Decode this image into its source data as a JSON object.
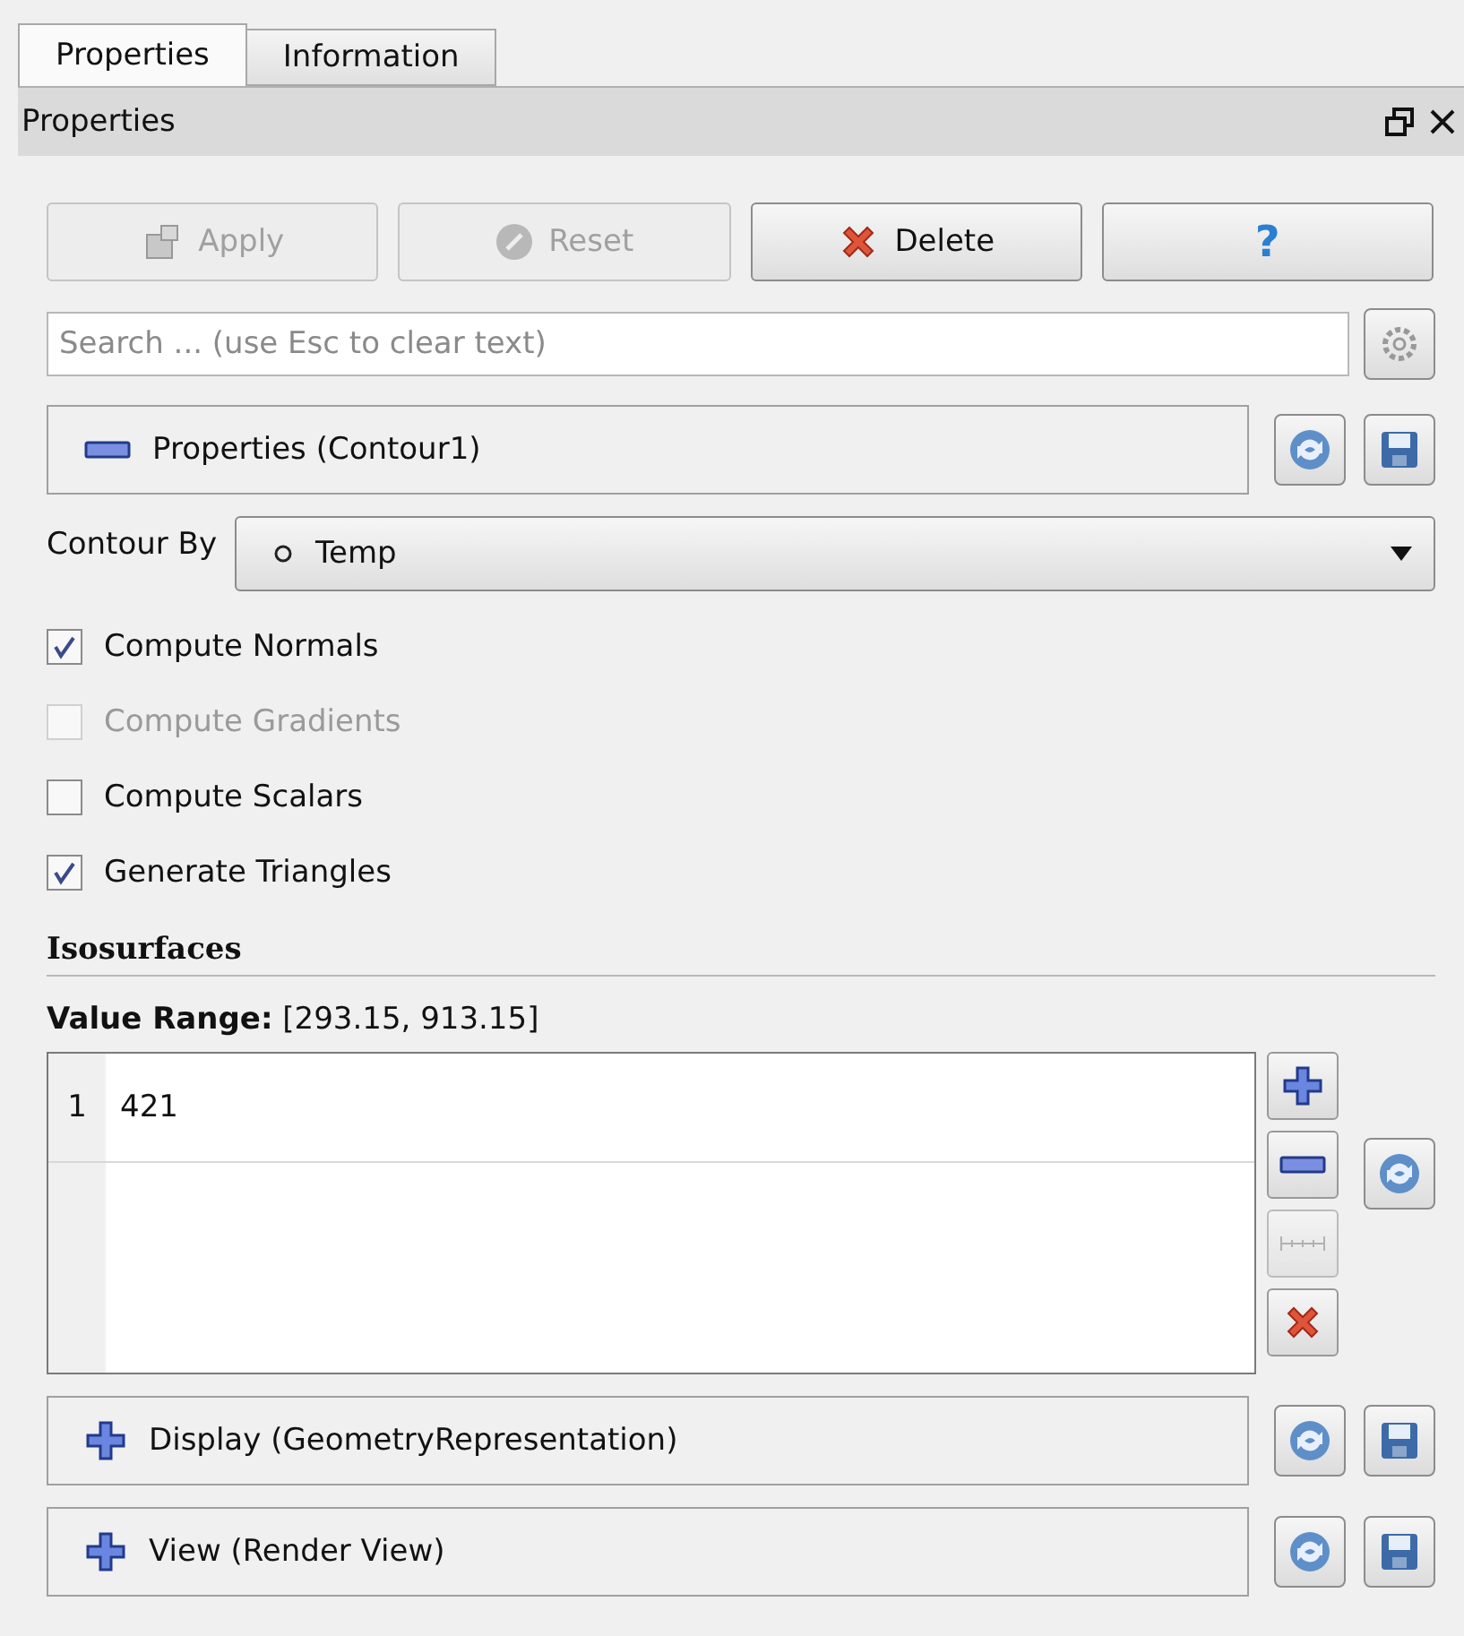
{
  "tabs": [
    {
      "label": "Properties",
      "selected": true
    },
    {
      "label": "Information",
      "selected": false
    }
  ],
  "dock": {
    "title": "Properties"
  },
  "buttons": [
    {
      "kind": "apply",
      "label": "Apply",
      "disabled": true
    },
    {
      "kind": "reset",
      "label": "Reset",
      "disabled": true
    },
    {
      "kind": "delete",
      "label": "Delete",
      "disabled": false
    },
    {
      "kind": "help",
      "label": "?",
      "disabled": false
    }
  ],
  "search": {
    "placeholder": "Search ... (use Esc to clear text)"
  },
  "sections": [
    {
      "title": "Properties (Contour1)",
      "expanded": true
    },
    {
      "title": "Display (GeometryRepresentation)",
      "expanded": false
    },
    {
      "title": "View (Render View)",
      "expanded": false
    }
  ],
  "contour_by": {
    "label": "Contour By",
    "value": "Temp"
  },
  "checkboxes": [
    {
      "label": "Compute Normals",
      "checked": true,
      "disabled": false
    },
    {
      "label": "Compute Gradients",
      "checked": false,
      "disabled": true
    },
    {
      "label": "Compute Scalars",
      "checked": false,
      "disabled": false
    },
    {
      "label": "Generate Triangles",
      "checked": true,
      "disabled": false
    }
  ],
  "isosurfaces": {
    "heading": "Isosurfaces",
    "range_label": "Value Range:",
    "range_value": "[293.15, 913.15]",
    "rows": [
      {
        "index": "1",
        "value": "421"
      }
    ]
  }
}
